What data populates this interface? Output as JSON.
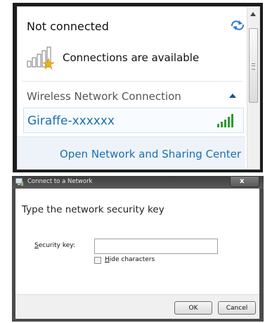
{
  "flyout": {
    "status_title": "Not connected",
    "connections_message": "Connections are available",
    "section_label": "Wireless Network Connection",
    "network_name": "Giraffe-xxxxxx",
    "open_center_link": "Open Network and Sharing Center",
    "icons": {
      "refresh": "refresh-icon",
      "no_connection_signal": "signal-bars-with-star-icon",
      "collapse": "chevron-up-icon",
      "network_signal": "signal-bars-green-icon"
    },
    "colors": {
      "link": "#1a6fb0",
      "signal_green": "#2e9b2e",
      "signal_grey": "#8c8c8c",
      "warning_star": "#f2b400"
    }
  },
  "dialog": {
    "title": "Connect to a Network",
    "instruction": "Type the network security key",
    "security_key_label_prefix": "S",
    "security_key_label_rest": "ecurity key:",
    "security_key_value": "",
    "hide_label_prefix": "H",
    "hide_label_rest": "ide characters",
    "hide_checked": false,
    "close_glyph": "x",
    "ok_label": "OK",
    "cancel_label": "Cancel"
  }
}
